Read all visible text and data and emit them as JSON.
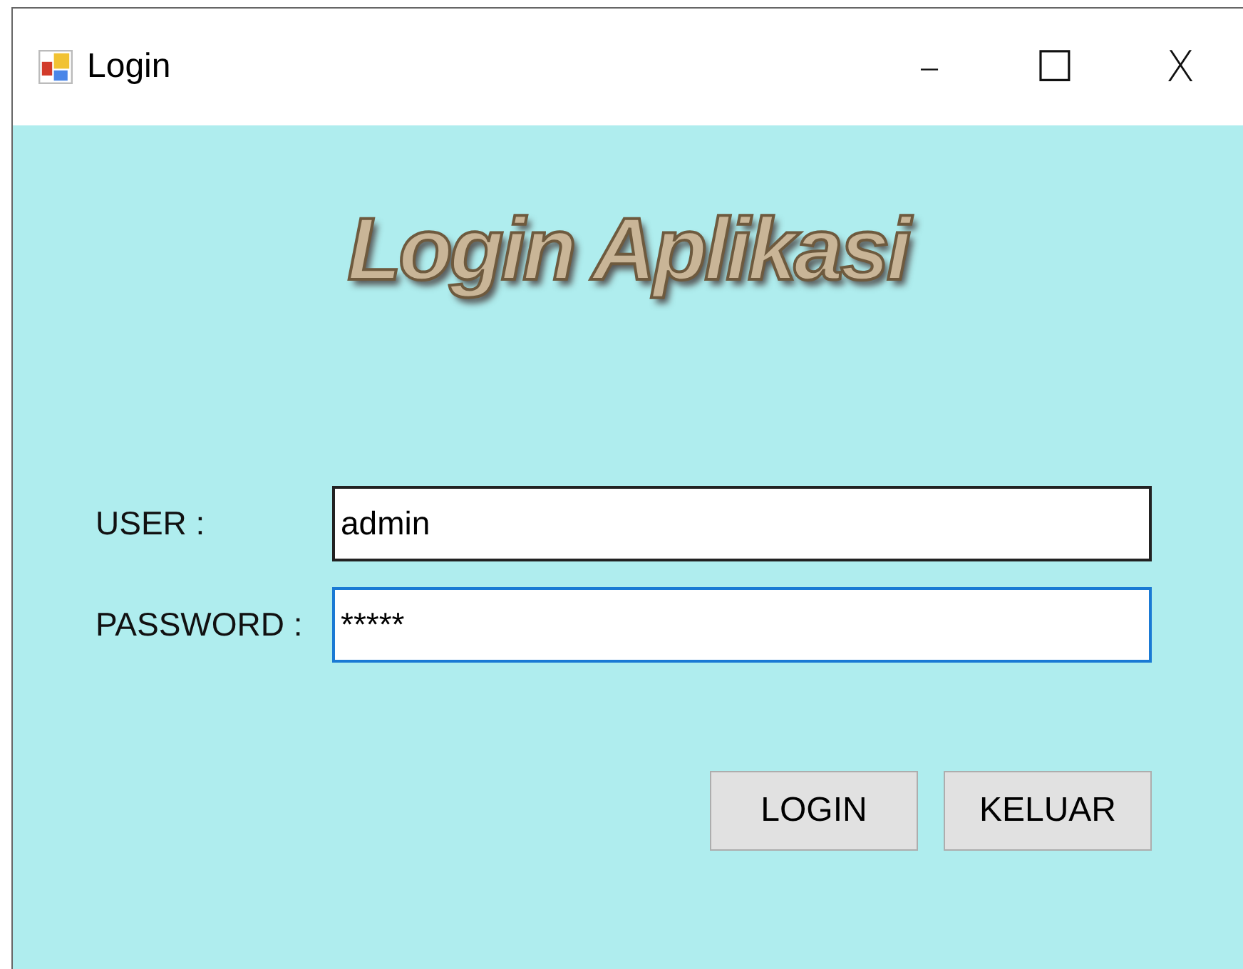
{
  "window": {
    "title": "Login",
    "controls": [
      "–",
      "☐",
      "X"
    ]
  },
  "heading": "Login Aplikasi",
  "fields": [
    {
      "label": "USER :",
      "value": "admin",
      "focused": false
    },
    {
      "label": "PASSWORD :",
      "value": "*****",
      "focused": true
    }
  ],
  "buttons": [
    "LOGIN",
    "KELUAR"
  ]
}
